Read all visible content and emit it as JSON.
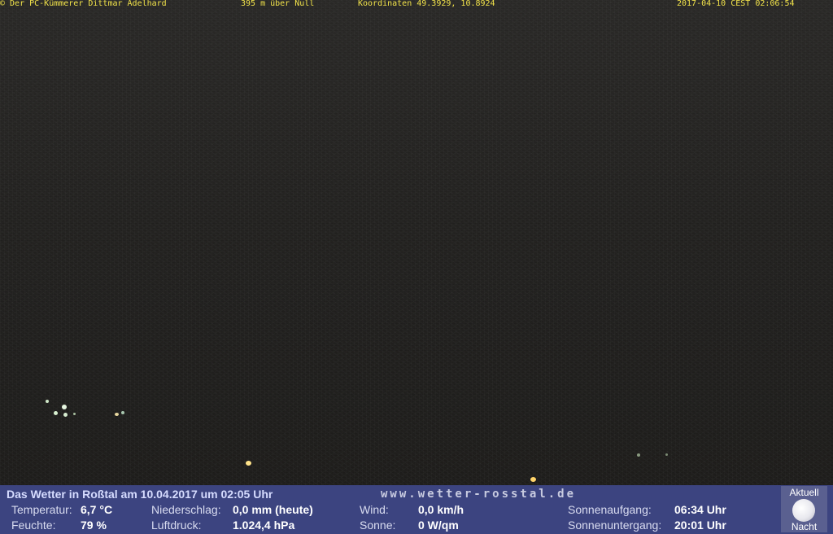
{
  "webcam": {
    "copyright": "© Der PC-Kümmerer Dittmar Adelhard",
    "altitude": "395 m über Null",
    "coordinates": "Koordinaten 49.3929, 10.8924",
    "timestamp": "2017-04-10 CEST 02:06:54"
  },
  "weather": {
    "title": "Das Wetter in Roßtal am 10.04.2017 um 02:05 Uhr",
    "site": "www.wetter-rosstal.de",
    "temperature_label": "Temperatur:",
    "temperature_value": "6,7 °C",
    "humidity_label": "Feuchte:",
    "humidity_value": "79 %",
    "precip_label": "Niederschlag:",
    "precip_value": "0,0 mm (heute)",
    "pressure_label": "Luftdruck:",
    "pressure_value": "1.024,4 hPa",
    "wind_label": "Wind:",
    "wind_value": "0,0 km/h",
    "sun_label": "Sonne:",
    "sun_value": "0 W/qm",
    "sunrise_label": "Sonnenaufgang:",
    "sunrise_value": "06:34 Uhr",
    "sunset_label": "Sonnenuntergang:",
    "sunset_value": "20:01 Uhr"
  },
  "moon": {
    "top_label": "Aktuell",
    "bottom_label": "Nacht",
    "icon": "full-moon-icon"
  }
}
